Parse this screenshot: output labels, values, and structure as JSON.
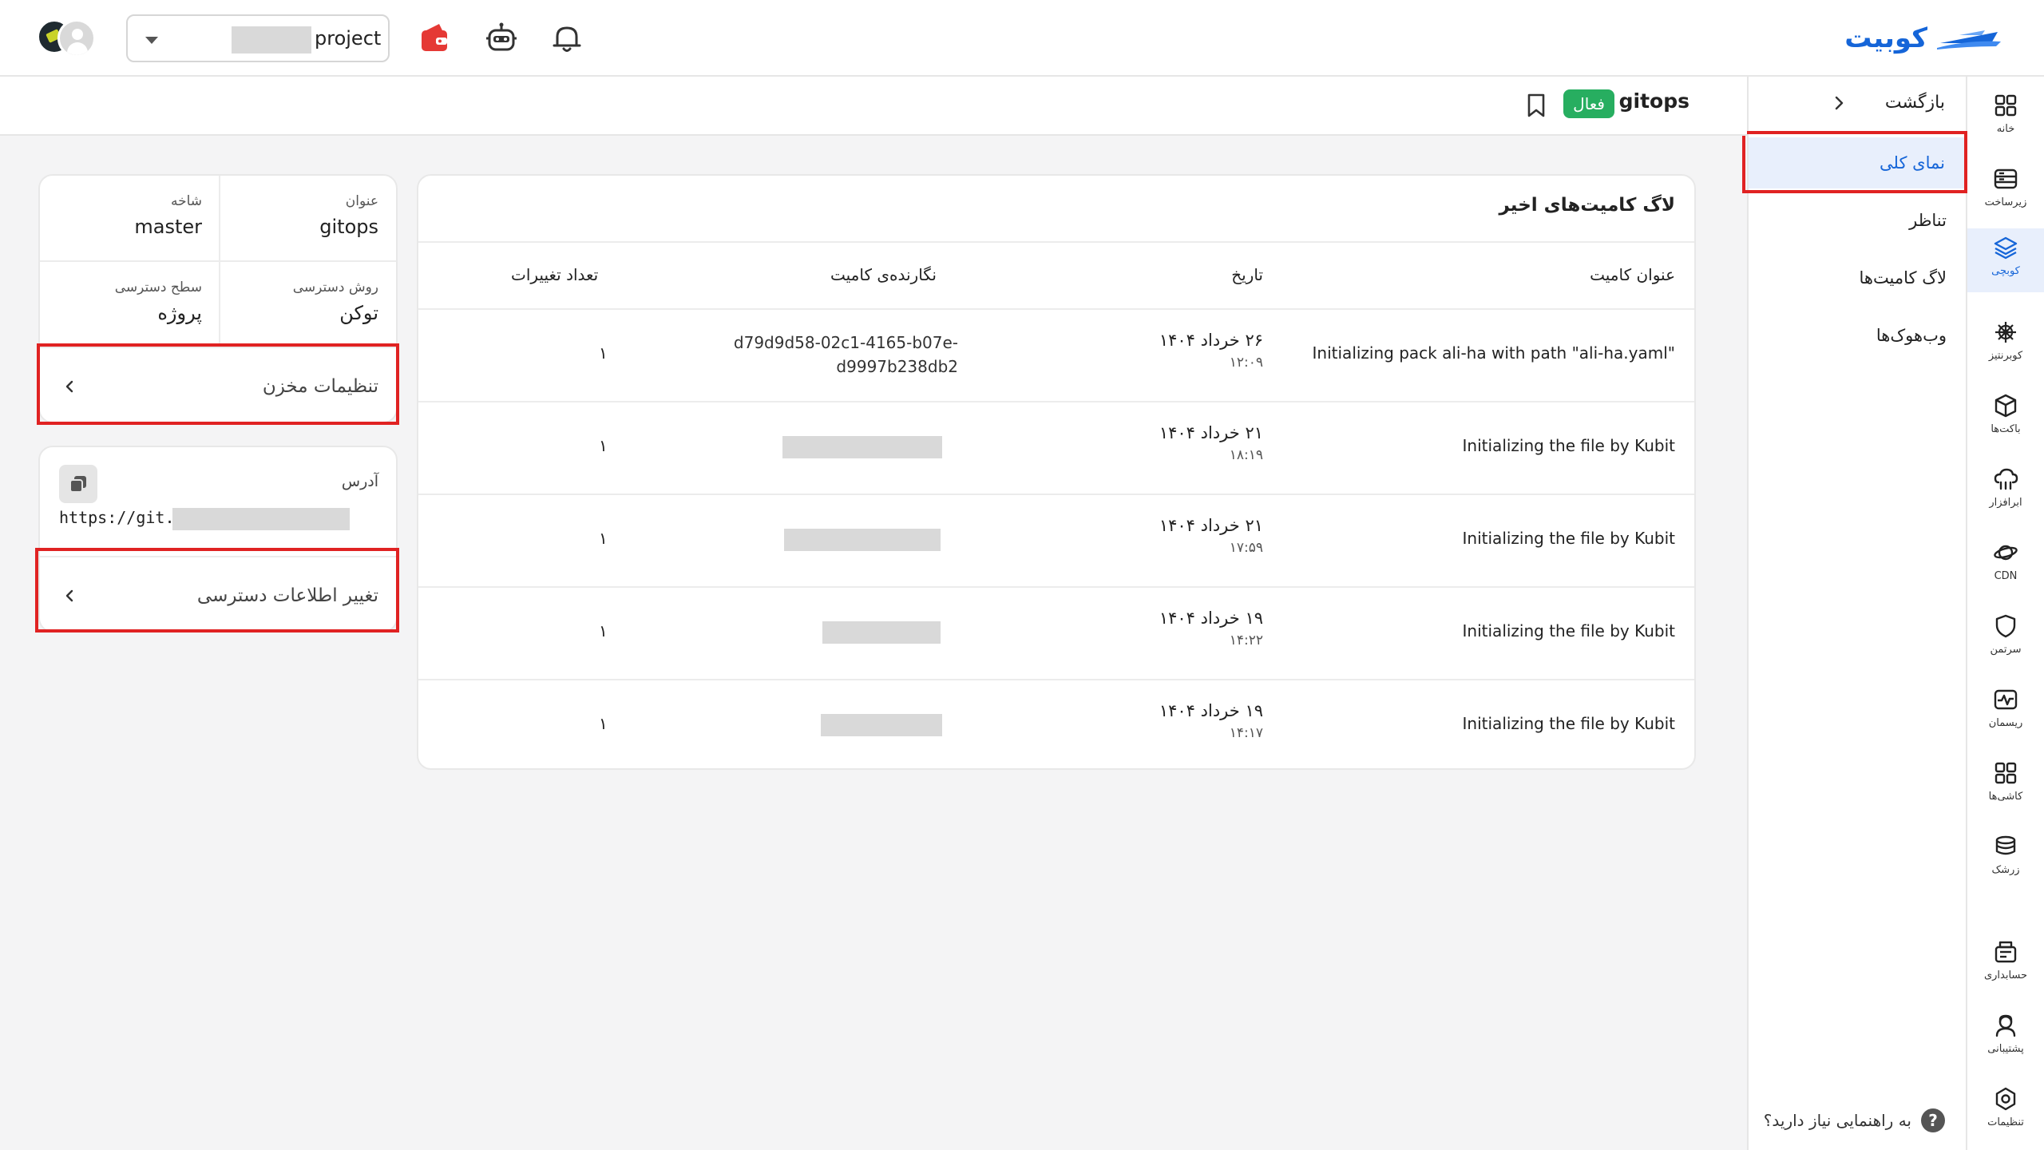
{
  "topbar": {
    "logo_text": "کوبیت",
    "project_value": "project",
    "icons": [
      "wallet-icon",
      "robot-icon",
      "bell-icon"
    ]
  },
  "rail": {
    "items": [
      {
        "label": "خانه",
        "icon": "grid-icon"
      },
      {
        "label": "زیرساخت",
        "icon": "server-icon"
      },
      {
        "label": "کوبچی",
        "icon": "layers-icon",
        "active": true
      },
      {
        "label": "کوبرنتیز",
        "icon": "helm-icon"
      },
      {
        "label": "باکت‌ها",
        "icon": "box-icon"
      },
      {
        "label": "ابرافزار",
        "icon": "cloud-app-icon"
      },
      {
        "label": "CDN",
        "icon": "planet-icon"
      },
      {
        "label": "سرتمن",
        "icon": "shield-icon"
      },
      {
        "label": "ریسمان",
        "icon": "pulse-icon"
      },
      {
        "label": "کاشی‌ها",
        "icon": "tiles-icon"
      },
      {
        "label": "زرشک",
        "icon": "stack-icon"
      },
      {
        "label": "حسابداری",
        "icon": "accounting-icon"
      },
      {
        "label": "پشتیبانی",
        "icon": "support-icon"
      },
      {
        "label": "تنظیمات",
        "icon": "settings-icon"
      }
    ],
    "accent": "#1565d8"
  },
  "subnav": {
    "back_label": "بازگشت",
    "items": [
      {
        "label": "نمای کلی",
        "active": true
      },
      {
        "label": "تناظر"
      },
      {
        "label": "لاگ کامیت‌ها"
      },
      {
        "label": "وب‌هوک‌ها"
      }
    ],
    "help_label": "به راهنمایی نیاز دارید؟"
  },
  "page": {
    "title": "gitops",
    "status_badge": "فعال",
    "status_color": "#27ae60"
  },
  "commits": {
    "title": "لاگ کامیت‌های اخیر",
    "headers": {
      "title": "عنوان کامیت",
      "date": "تاریخ",
      "author": "نگارنده‌ی کامیت",
      "changes": "تعداد تغییرات"
    },
    "rows": [
      {
        "title": "Initializing pack ali-ha with path \"ali-ha.yaml\"",
        "date": "۲۶ خرداد ۱۴۰۴",
        "time": "۱۲:۰۹",
        "author_line1": "d79d9d58-02c1-4165-b07e-",
        "author_line2": "d9997b238db2",
        "changes": "۱"
      },
      {
        "title": "Initializing the file by Kubit",
        "date": "۲۱ خرداد ۱۴۰۴",
        "time": "۱۸:۱۹",
        "author_line1": "",
        "author_line2": "",
        "changes": "۱"
      },
      {
        "title": "Initializing the file by Kubit",
        "date": "۲۱ خرداد ۱۴۰۴",
        "time": "۱۷:۵۹",
        "author_line1": "",
        "author_line2": "",
        "changes": "۱"
      },
      {
        "title": "Initializing the file by Kubit",
        "date": "۱۹ خرداد ۱۴۰۴",
        "time": "۱۴:۲۲",
        "author_line1": "",
        "author_line2": "",
        "changes": "۱"
      },
      {
        "title": "Initializing the file by Kubit",
        "date": "۱۹ خرداد ۱۴۰۴",
        "time": "۱۴:۱۷",
        "author_line1": "",
        "author_line2": "",
        "changes": "۱"
      }
    ]
  },
  "info": {
    "name_label": "عنوان",
    "name_value": "gitops",
    "branch_label": "شاخه",
    "branch_value": "master",
    "access_method_label": "روش دسترسی",
    "access_method_value": "توکن",
    "access_level_label": "سطح دسترسی",
    "access_level_value": "پروژه",
    "repo_settings_label": "تنظیمات مخزن"
  },
  "address": {
    "label": "آدرس",
    "value": "https://git.",
    "change_access_label": "تغییر اطلاعات دسترسی"
  },
  "highlight_color": "#e02222"
}
